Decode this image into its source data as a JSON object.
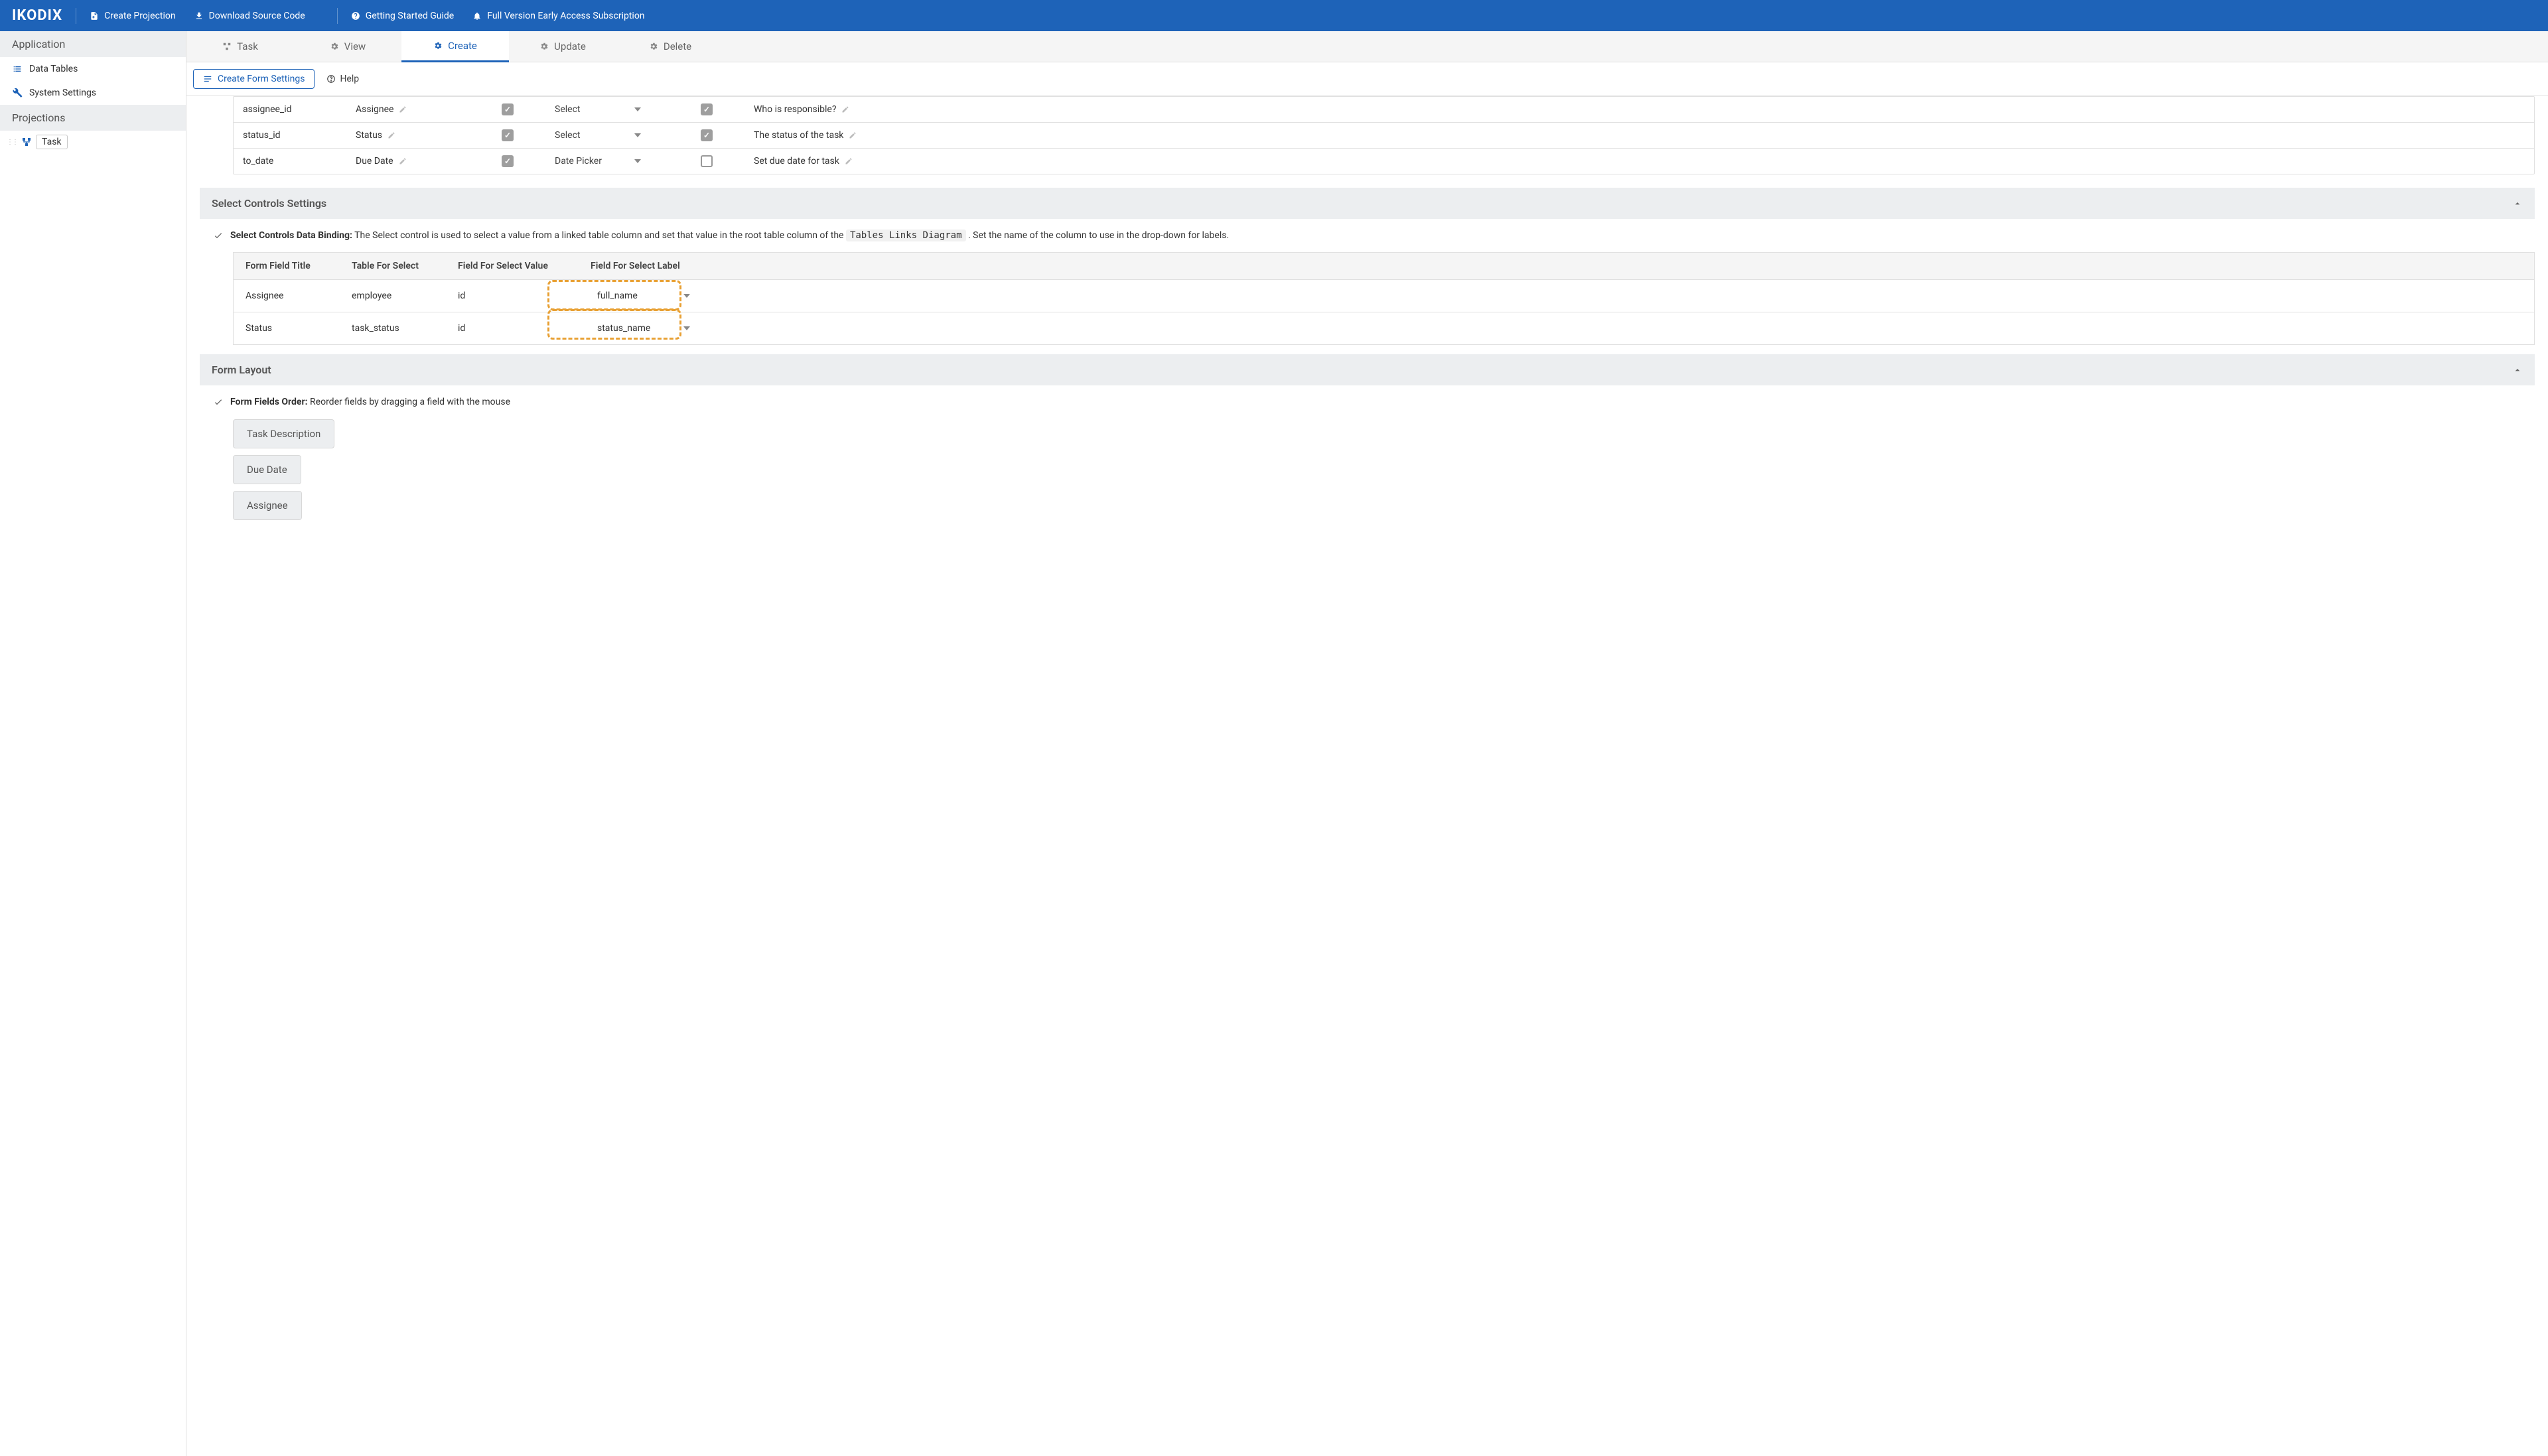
{
  "header": {
    "logo": "IKODIX",
    "links": {
      "create_projection": "Create Projection",
      "download_source": "Download Source Code",
      "getting_started": "Getting Started Guide",
      "subscription": "Full Version Early Access Subscription"
    }
  },
  "sidebar": {
    "section_app": "Application",
    "item_data_tables": "Data Tables",
    "item_system_settings": "System Settings",
    "section_projections": "Projections",
    "projection_task": "Task"
  },
  "tabs": {
    "task": "Task",
    "view": "View",
    "create": "Create",
    "update": "Update",
    "delete": "Delete"
  },
  "subtabs": {
    "create_form_settings": "Create Form Settings",
    "help": "Help"
  },
  "fields": [
    {
      "name": "assignee_id",
      "title": "Assignee",
      "checked1": true,
      "control": "Select",
      "checked2": true,
      "hint": "Who is responsible?"
    },
    {
      "name": "status_id",
      "title": "Status",
      "checked1": true,
      "control": "Select",
      "checked2": true,
      "hint": "The status of the task"
    },
    {
      "name": "to_date",
      "title": "Due Date",
      "checked1": true,
      "control": "Date Picker",
      "checked2": false,
      "hint": "Set due date for task"
    }
  ],
  "panels": {
    "select_controls": "Select Controls Settings",
    "form_layout": "Form Layout"
  },
  "select_info": {
    "lead": "Select Controls Data Binding:",
    "text_a": "The Select control is used to select a value from a linked table column and set that value in the root table column of the ",
    "code": "Tables Links Diagram",
    "text_b": ". Set the name of the column to use in the drop-down for labels."
  },
  "sc_table": {
    "headers": {
      "title": "Form Field Title",
      "table": "Table For Select",
      "value": "Field For Select Value",
      "label": "Field For Select Label"
    },
    "rows": [
      {
        "title": "Assignee",
        "table": "employee",
        "value": "id",
        "label": "full_name"
      },
      {
        "title": "Status",
        "table": "task_status",
        "value": "id",
        "label": "status_name"
      }
    ]
  },
  "form_layout_info": {
    "lead": "Form Fields Order:",
    "text": "Reorder fields by dragging a field with the mouse"
  },
  "layout_chips": [
    "Task Description",
    "Due Date",
    "Assignee"
  ]
}
